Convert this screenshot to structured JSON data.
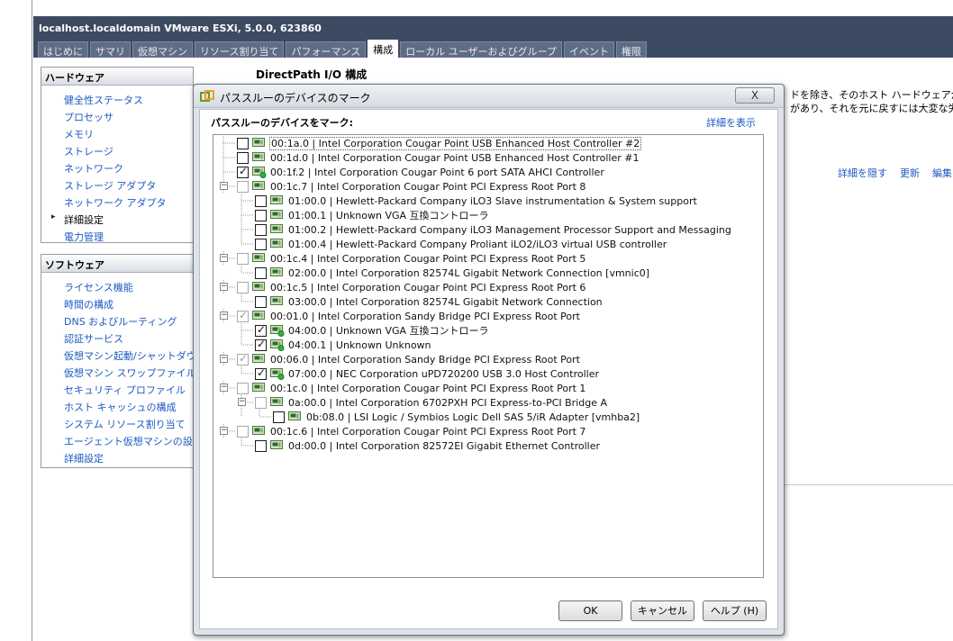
{
  "window": {
    "title": "localhost.localdomain VMware ESXi, 5.0.0, 623860",
    "tabs": [
      "はじめに",
      "サマリ",
      "仮想マシン",
      "リソース割り当て",
      "パフォーマンス",
      "構成",
      "ローカル ユーザーおよびグループ",
      "イベント",
      "権限"
    ],
    "active_tab": "構成"
  },
  "nav": {
    "hardware": {
      "title": "ハードウェア",
      "items": [
        "健全性ステータス",
        "プロセッサ",
        "メモリ",
        "ストレージ",
        "ネットワーク",
        "ストレージ アダプタ",
        "ネットワーク アダプタ",
        "詳細設定",
        "電力管理"
      ]
    },
    "software": {
      "title": "ソフトウェア",
      "items": [
        "ライセンス機能",
        "時間の構成",
        "DNS およびルーティング",
        "認証サービス",
        "仮想マシン起動/シャットダウン",
        "仮想マシン スワップファイルの場所",
        "セキュリティ プロファイル",
        "ホスト キャッシュの構成",
        "システム リソース割り当て",
        "エージェント仮想マシンの設定",
        "詳細設定"
      ]
    }
  },
  "main": {
    "heading": "DirectPath I/O 構成",
    "bg_text_1": "ドを除き、そのホスト ハードウェアが使用で",
    "bg_text_2": "があり、それを元に戻すには大変な労力",
    "links": [
      "詳細を隠す",
      "更新",
      "編集"
    ]
  },
  "dialog": {
    "title": "パススルーのデバイスのマーク",
    "label": "パススルーのデバイスをマーク:",
    "detail_link": "詳細を表示",
    "close_label": "X",
    "buttons": {
      "ok": "OK",
      "cancel": "キャンセル",
      "help": "ヘルプ (H)"
    },
    "devices": [
      {
        "text": "00:1a.0 | Intel Corporation Cougar Point USB Enhanced Host Controller #2",
        "level": 0,
        "checked": false,
        "gray": false,
        "selected": true,
        "expander": false,
        "active": false
      },
      {
        "text": "00:1d.0 | Intel Corporation Cougar Point USB Enhanced Host Controller #1",
        "level": 0,
        "checked": false,
        "gray": false,
        "selected": false,
        "expander": false,
        "active": false
      },
      {
        "text": "00:1f.2 | Intel Corporation Cougar Point 6 port SATA AHCI Controller",
        "level": 0,
        "checked": true,
        "gray": false,
        "selected": false,
        "expander": false,
        "active": true
      },
      {
        "text": "00:1c.7 | Intel Corporation Cougar Point PCI Express Root Port 8",
        "level": 0,
        "checked": false,
        "gray": true,
        "selected": false,
        "expander": true,
        "active": false
      },
      {
        "text": "01:00.0 | Hewlett-Packard Company iLO3 Slave instrumentation & System support",
        "level": 1,
        "checked": false,
        "gray": false,
        "selected": false,
        "expander": false,
        "active": false
      },
      {
        "text": "01:00.1 | Unknown VGA 互換コントローラ",
        "level": 1,
        "checked": false,
        "gray": false,
        "selected": false,
        "expander": false,
        "active": false
      },
      {
        "text": "01:00.2 | Hewlett-Packard Company iLO3 Management Processor Support and Messaging",
        "level": 1,
        "checked": false,
        "gray": false,
        "selected": false,
        "expander": false,
        "active": false
      },
      {
        "text": "01:00.4 | Hewlett-Packard Company Proliant iLO2/iLO3 virtual USB controller",
        "level": 1,
        "checked": false,
        "gray": false,
        "selected": false,
        "expander": false,
        "active": false
      },
      {
        "text": "00:1c.4 | Intel Corporation Cougar Point PCI Express Root Port 5",
        "level": 0,
        "checked": false,
        "gray": true,
        "selected": false,
        "expander": true,
        "active": false
      },
      {
        "text": "02:00.0 | Intel Corporation 82574L Gigabit Network Connection [vmnic0]",
        "level": 1,
        "checked": false,
        "gray": false,
        "selected": false,
        "expander": false,
        "active": false
      },
      {
        "text": "00:1c.5 | Intel Corporation Cougar Point PCI Express Root Port 6",
        "level": 0,
        "checked": false,
        "gray": true,
        "selected": false,
        "expander": true,
        "active": false
      },
      {
        "text": "03:00.0 | Intel Corporation 82574L Gigabit Network Connection",
        "level": 1,
        "checked": false,
        "gray": false,
        "selected": false,
        "expander": false,
        "active": false
      },
      {
        "text": "00:01.0 | Intel Corporation Sandy Bridge PCI Express Root Port",
        "level": 0,
        "checked": true,
        "gray": true,
        "selected": false,
        "expander": true,
        "active": false
      },
      {
        "text": "04:00.0 | Unknown VGA 互換コントローラ",
        "level": 1,
        "checked": true,
        "gray": false,
        "selected": false,
        "expander": false,
        "active": true
      },
      {
        "text": "04:00.1 | Unknown Unknown",
        "level": 1,
        "checked": true,
        "gray": false,
        "selected": false,
        "expander": false,
        "active": true
      },
      {
        "text": "00:06.0 | Intel Corporation Sandy Bridge PCI Express Root Port",
        "level": 0,
        "checked": true,
        "gray": true,
        "selected": false,
        "expander": true,
        "active": false
      },
      {
        "text": "07:00.0 | NEC Corporation uPD720200 USB 3.0 Host Controller",
        "level": 1,
        "checked": true,
        "gray": false,
        "selected": false,
        "expander": false,
        "active": true
      },
      {
        "text": "00:1c.0 | Intel Corporation Cougar Point PCI Express Root Port 1",
        "level": 0,
        "checked": false,
        "gray": true,
        "selected": false,
        "expander": true,
        "active": false
      },
      {
        "text": "0a:00.0 | Intel Corporation 6702PXH PCI Express-to-PCI Bridge A",
        "level": 1,
        "checked": false,
        "gray": true,
        "selected": false,
        "expander": true,
        "active": false
      },
      {
        "text": "0b:08.0 | LSI Logic / Symbios Logic Dell SAS 5/iR Adapter [vmhba2]",
        "level": 2,
        "checked": false,
        "gray": false,
        "selected": false,
        "expander": false,
        "active": false
      },
      {
        "text": "00:1c.6 | Intel Corporation Cougar Point PCI Express Root Port 7",
        "level": 0,
        "checked": false,
        "gray": true,
        "selected": false,
        "expander": true,
        "active": false
      },
      {
        "text": "0d:00.0 | Intel Corporation 82572EI Gigabit Ethernet Controller",
        "level": 1,
        "checked": false,
        "gray": false,
        "selected": false,
        "expander": false,
        "active": false
      }
    ]
  }
}
